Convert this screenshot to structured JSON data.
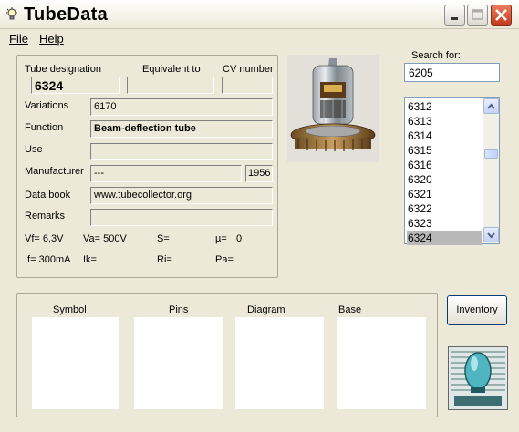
{
  "window": {
    "title": "TubeData"
  },
  "menu": {
    "file": "File",
    "help": "Help"
  },
  "fields": {
    "designation_label": "Tube designation",
    "designation_value": "6324",
    "equivalent_label": "Equivalent to",
    "equivalent_value": "",
    "cv_label": "CV number",
    "cv_value": "",
    "variations_label": "Variations",
    "variations_value": "6170",
    "function_label": "Function",
    "function_value": "Beam-deflection tube",
    "use_label": "Use",
    "use_value": "",
    "manufacturer_label": "Manufacturer",
    "manufacturer_value": "---",
    "year_value": "1956",
    "databook_label": "Data book",
    "databook_value": "www.tubecollector.org",
    "remarks_label": "Remarks",
    "remarks_value": ""
  },
  "specs": {
    "vf": "Vf= 6,3V",
    "va": "Va= 500V",
    "s": "S=",
    "mu": "µ=",
    "mu_value": "0",
    "if": "If= 300mA",
    "ik": "Ik=",
    "ri": "Ri=",
    "pa": "Pa="
  },
  "search": {
    "label": "Search for:",
    "value": "6205"
  },
  "list": {
    "items": [
      "6312",
      "6313",
      "6314",
      "6315",
      "6316",
      "6320",
      "6321",
      "6322",
      "6323",
      "6324"
    ],
    "selected": "6324"
  },
  "bottom": {
    "symbol": "Symbol",
    "pins": "Pins",
    "diagram": "Diagram",
    "base": "Base",
    "inventory_button": "Inventory"
  }
}
